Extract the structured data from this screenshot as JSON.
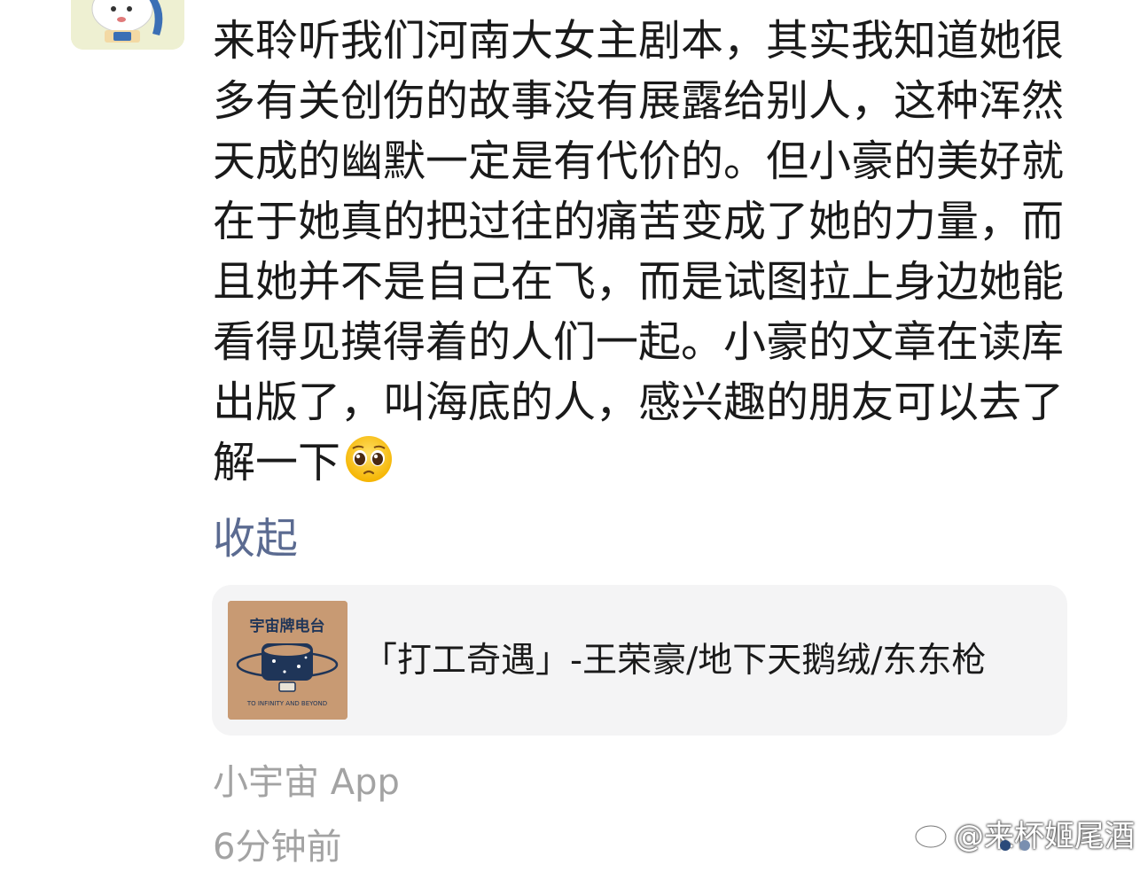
{
  "post": {
    "text": "来聆听我们河南大女主剧本，其实我知道她很多有关创伤的故事没有展露给别人，这种浑然天成的幽默一定是有代价的。但小豪的美好就在于她真的把过往的痛苦变成了她的力量，而且她并不是自己在飞，而是试图拉上身边她能看得见摸得着的人们一起。小豪的文章在读库出版了，叫海底的人，感兴趣的朋友可以去了解一下",
    "emoji_icon": "pleading-face-emoji",
    "collapse_label": "收起"
  },
  "card": {
    "title": "「打工奇遇」-王荣豪/地下天鹅绒/东东枪",
    "cover_icon": "podcast-cover-planet-art"
  },
  "meta": {
    "source": "小宇宙 App",
    "time": "6分钟前"
  },
  "watermark": {
    "text": "@来杯姬尾酒",
    "icon": "weibo-logo-icon"
  },
  "colors": {
    "text": "#1a1a1a",
    "link": "#5b6b91",
    "meta": "#a3a3a3",
    "card_bg": "#f4f4f5",
    "cover_bg": "#c89a73",
    "dot_active": "#2a4a7a",
    "dot_inactive": "#7a8fb0"
  }
}
